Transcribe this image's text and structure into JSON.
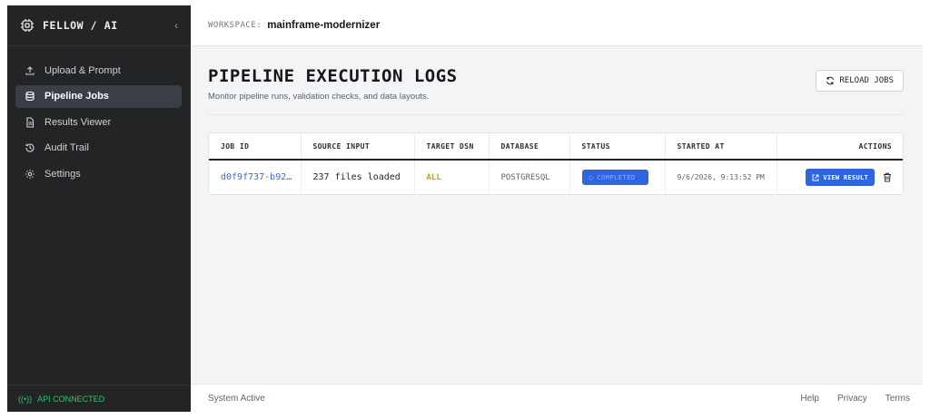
{
  "sidebar": {
    "brand": "FELLOW / AI",
    "collapse_icon": "chevron-left-icon",
    "items": [
      {
        "label": "Upload & Prompt",
        "icon": "upload-icon",
        "active": false
      },
      {
        "label": "Pipeline Jobs",
        "icon": "database-icon",
        "active": true
      },
      {
        "label": "Results Viewer",
        "icon": "document-icon",
        "active": false
      },
      {
        "label": "Audit Trail",
        "icon": "history-icon",
        "active": false
      },
      {
        "label": "Settings",
        "icon": "gear-icon",
        "active": false
      }
    ],
    "api_status": "API CONNECTED",
    "api_status_color": "#31c46a"
  },
  "topbar": {
    "workspace_label": "WORKSPACE:",
    "workspace_name": "mainframe-modernizer"
  },
  "page": {
    "title": "PIPELINE EXECUTION LOGS",
    "subtitle": "Monitor pipeline runs, validation checks, and data layouts.",
    "reload_label": "RELOAD JOBS"
  },
  "table": {
    "columns": [
      "JOB ID",
      "SOURCE INPUT",
      "TARGET DSN",
      "DATABASE",
      "STATUS",
      "STARTED AT",
      "ACTIONS"
    ],
    "rows": [
      {
        "job_id": "d0f9f737-b92…",
        "source_input": "237 files loaded",
        "target_dsn": "ALL",
        "database": "POSTGRESQL",
        "status": "COMPLETED",
        "started_at": "9/6/2026, 9:13:52 PM",
        "action_label": "VIEW RESULT"
      }
    ]
  },
  "footer": {
    "status": "System Active",
    "links": [
      "Help",
      "Privacy",
      "Terms"
    ]
  },
  "colors": {
    "accent": "#2f66e0",
    "sidebar_bg": "#232426",
    "dsn": "#d29a12",
    "link": "#3a67d6"
  }
}
